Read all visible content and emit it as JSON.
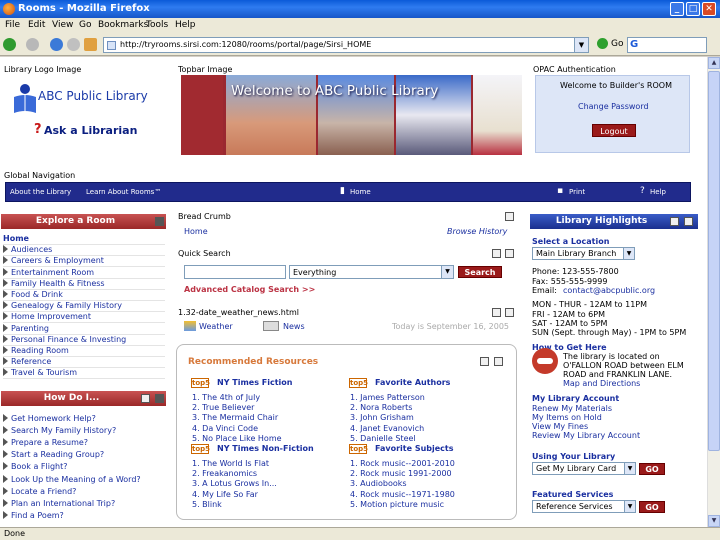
{
  "window": {
    "title": "Rooms - Mozilla Firefox",
    "controls": [
      "_",
      "□",
      "✕"
    ]
  },
  "menubar": [
    "File",
    "Edit",
    "View",
    "Go",
    "Bookmarks",
    "Tools",
    "Help"
  ],
  "navbar": {
    "url": "http://tryrooms.sirsi.com:12080/rooms/portal/page/Sirsi_HOME",
    "go_label": "Go",
    "search_logo": "G"
  },
  "page": {
    "library_logo_label": "Library Logo Image",
    "library_name": "ABC Public Library",
    "ask_librarian": "Ask a Librarian",
    "ask_q": "?",
    "topbar_label": "Topbar Image",
    "welcome_banner": "Welcome to ABC Public Library",
    "opac_label": "OPAC Authentication",
    "opac_welcome": "Welcome to Builder's ROOM",
    "change_password": "Change Password",
    "logout": "Logout",
    "global_nav_label": "Global Navigation",
    "global_nav": {
      "about": "About the Library",
      "learn": "Learn About Rooms™",
      "home": "Home",
      "print": "Print",
      "help": "Help"
    }
  },
  "explore": {
    "title": "Explore a Room",
    "items": [
      "Home",
      "Audiences",
      "Careers & Employment",
      "Entertainment Room",
      "Family Health & Fitness",
      "Food & Drink",
      "Genealogy & Family History",
      "Home Improvement",
      "Parenting",
      "Personal Finance & Investing",
      "Reading Room",
      "Reference",
      "Travel & Tourism"
    ]
  },
  "howdoi": {
    "title": "How Do I...",
    "items": [
      "Get Homework Help?",
      "Search My Family History?",
      "Prepare a Resume?",
      "Start a Reading Group?",
      "Book a Flight?",
      "Look Up the Meaning of a Word?",
      "Locate a Friend?",
      "Plan an International Trip?",
      "Find a Poem?"
    ]
  },
  "middle": {
    "breadcrumb_label": "Bread Crumb",
    "breadcrumb_home": "Home",
    "browse_history": "Browse History",
    "quick_search_label": "Quick Search",
    "search_scope": "Everything",
    "search_button": "Search",
    "advanced": "Advanced Catalog Search >>",
    "file_label": "1.32-date_weather_news.html",
    "weather": "Weather",
    "news": "News",
    "today": "Today is September 16, 2005"
  },
  "recommended": {
    "title": "Recommended Resources",
    "top5": "top5",
    "lists": [
      {
        "title": "NY Times Fiction",
        "items": [
          "1. The 4th of July",
          "2. True Believer",
          "3. The Mermaid Chair",
          "4. Da Vinci Code",
          "5. No Place Like Home"
        ]
      },
      {
        "title": "Favorite Authors",
        "items": [
          "1. James Patterson",
          "2. Nora Roberts",
          "3. John Grisham",
          "4. Janet Evanovich",
          "5. Danielle Steel"
        ]
      },
      {
        "title": "NY Times Non-Fiction",
        "items": [
          "1. The World Is Flat",
          "2. Freakanomics",
          "3. A Lotus Grows In...",
          "4. My Life So Far",
          "5. Blink"
        ]
      },
      {
        "title": "Favorite Subjects",
        "items": [
          "1. Rock music--2001-2010",
          "2. Rock music 1991-2000",
          "3. Audiobooks",
          "4. Rock music--1971-1980",
          "5. Motion picture music"
        ]
      }
    ]
  },
  "highlights": {
    "title": "Library Highlights",
    "select_location": "Select a Location",
    "location_value": "Main Library Branch",
    "phone": "Phone: 123-555-7800",
    "fax": "Fax:     555-555-9999",
    "email_label": "Email:",
    "email": "contact@abcpublic.org",
    "hours": [
      "MON - THUR - 12AM to 11PM",
      "FRI - 12AM to 6PM",
      "SAT - 12AM to 5PM",
      "SUN (Sept. through May) - 1PM to 5PM"
    ],
    "how_to_get_here": "How to Get Here",
    "directions_text": [
      "The library is located on",
      "O'FALLON ROAD between ELM",
      "ROAD and FRANKLIN LANE."
    ],
    "map_link": "Map and Directions",
    "account_title": "My Library Account",
    "account_links": [
      "Renew My Materials",
      "My Items on Hold",
      "View My Fines",
      "Review My Library Account"
    ],
    "using_card": "Using Your Library",
    "card_select": "Get My Library Card",
    "go": "GO",
    "featured": "Featured Services",
    "featured_select": "Reference Services"
  },
  "status": "Done"
}
